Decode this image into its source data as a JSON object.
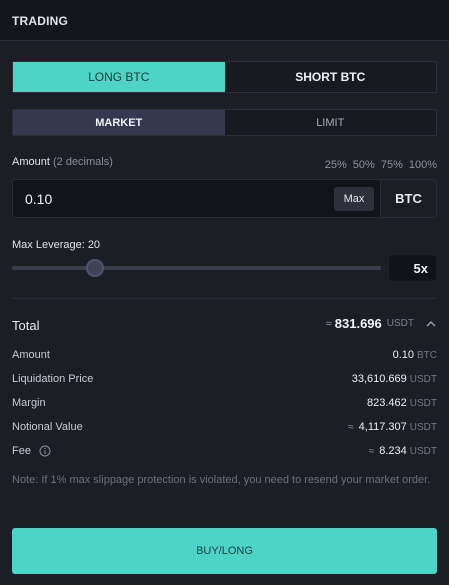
{
  "header": {
    "title": "TRADING"
  },
  "side_tabs": {
    "long": "LONG BTC",
    "short": "SHORT BTC"
  },
  "order_types": {
    "market": "MARKET",
    "limit": "LIMIT"
  },
  "amount": {
    "label": "Amount",
    "hint": "(2 decimals)",
    "percentages": [
      "25%",
      "50%",
      "75%",
      "100%"
    ],
    "value": "0.10",
    "max_label": "Max",
    "unit": "BTC"
  },
  "leverage": {
    "label": "Max Leverage: 20",
    "value": "5x",
    "level": 5,
    "max": 20
  },
  "total": {
    "label": "Total",
    "approx": "≈",
    "value": "831.696",
    "unit": "USDT"
  },
  "details": {
    "amount": {
      "label": "Amount",
      "value": "0.10",
      "unit": "BTC"
    },
    "liquidation_price": {
      "label": "Liquidation Price",
      "value": "33,610.669",
      "unit": "USDT"
    },
    "margin": {
      "label": "Margin",
      "value": "823.462",
      "unit": "USDT"
    },
    "notional_value": {
      "label": "Notional Value",
      "approx": "≈",
      "value": "4,117.307",
      "unit": "USDT"
    },
    "fee": {
      "label": "Fee",
      "approx": "≈",
      "value": "8.234",
      "unit": "USDT"
    }
  },
  "note": "Note: If 1% max slippage protection is violated, you need to resend your market order.",
  "submit_label": "BUY/LONG",
  "colors": {
    "accent": "#4ed3c7",
    "background": "#1c1e26",
    "header": "#15161c"
  }
}
